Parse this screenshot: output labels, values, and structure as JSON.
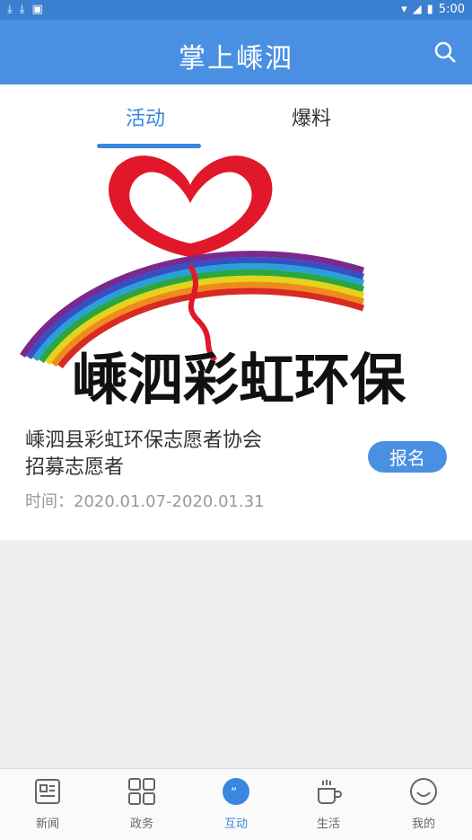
{
  "status": {
    "time": "5:00"
  },
  "appbar": {
    "title": "掌上嵊泗"
  },
  "tabs": [
    {
      "label": "活动"
    },
    {
      "label": "爆料"
    }
  ],
  "banner": {
    "text": "嵊泗彩虹环保"
  },
  "activity": {
    "title_line1": "嵊泗县彩虹环保志愿者协会",
    "title_line2": "招募志愿者",
    "signup_label": "报名",
    "time": "时间：2020.01.07-2020.01.31"
  },
  "bottom_nav": [
    {
      "label": "新闻"
    },
    {
      "label": "政务"
    },
    {
      "label": "互动"
    },
    {
      "label": "生活"
    },
    {
      "label": "我的"
    }
  ],
  "colors": {
    "primary": "#4a90e2",
    "accent": "#3a86e0"
  }
}
